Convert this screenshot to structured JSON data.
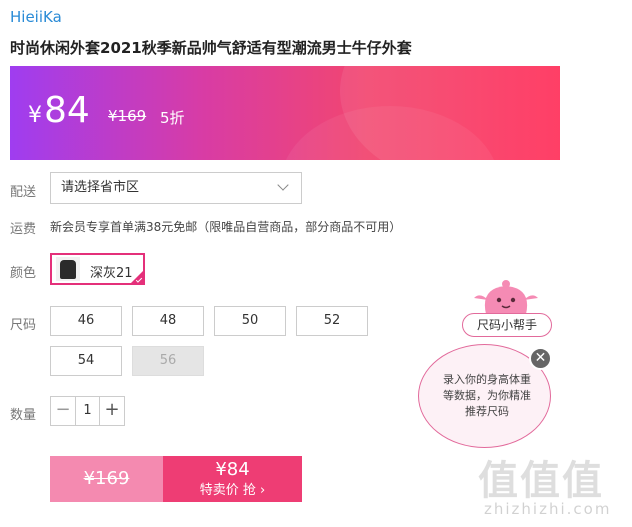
{
  "brand": "HieiiKa",
  "title": "时尚休闲外套2021秋季新品帅气舒适有型潮流男士牛仔外套",
  "price": {
    "currency": "¥",
    "current": "84",
    "original": "¥169",
    "discount": "5折"
  },
  "delivery": {
    "label": "配送",
    "placeholder": "请选择省市区"
  },
  "shipping": {
    "label": "运费",
    "text": "新会员专享首单满38元免邮（限唯品自营商品，部分商品不可用）"
  },
  "color": {
    "label": "颜色",
    "selected": "深灰21"
  },
  "size": {
    "label": "尺码",
    "options": [
      "46",
      "48",
      "50",
      "52",
      "54",
      "56"
    ],
    "disabled": [
      "56"
    ]
  },
  "quantity": {
    "label": "数量",
    "value": "1",
    "minus": "−",
    "plus": "+"
  },
  "buy": {
    "original": "¥169",
    "price": "¥84",
    "cta": "特卖价 抢 ›"
  },
  "size_helper": {
    "tag": "尺码小帮手",
    "bubble": "录入你的身高体重等数据，为你精准推荐尺码",
    "close": "✕"
  },
  "watermark": {
    "logo": "值值值",
    "url": "zhizhizhi.com"
  },
  "colors": {
    "accent": "#ee3d74",
    "brand_link": "#2a8bd6"
  }
}
